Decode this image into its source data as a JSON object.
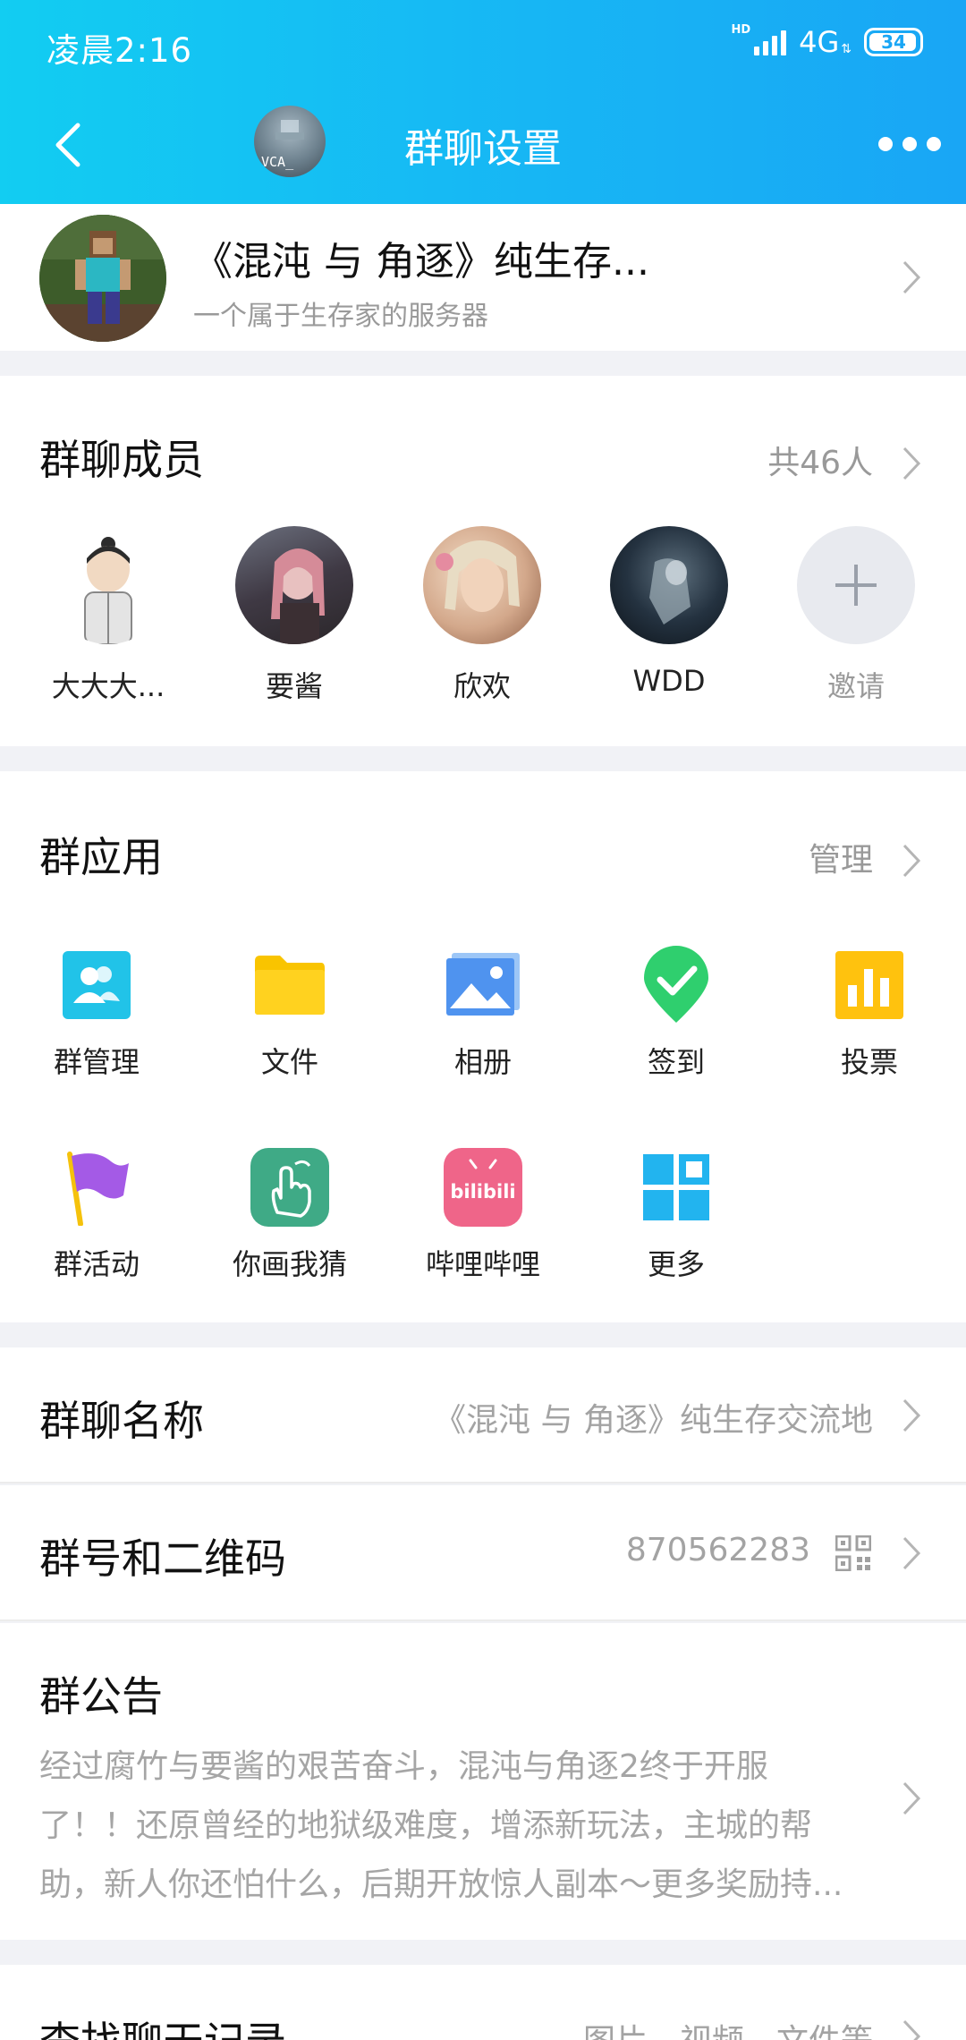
{
  "status_bar": {
    "time": "凌晨2:16",
    "hd": "HD",
    "network": "4G",
    "battery": "34"
  },
  "nav": {
    "title": "群聊设置",
    "group_thumb_text": "VCA_"
  },
  "group": {
    "name": "《混沌 与 角逐》纯生存...",
    "description": "一个属于生存家的服务器"
  },
  "members": {
    "title": "群聊成员",
    "count": "共46人",
    "list": [
      {
        "name": "大大大..."
      },
      {
        "name": "要酱"
      },
      {
        "name": "欣欢"
      },
      {
        "name": "WDD"
      }
    ],
    "invite_label": "邀请"
  },
  "apps": {
    "title": "群应用",
    "manage": "管理",
    "items": [
      {
        "label": "群管理",
        "icon": "group-manage-icon"
      },
      {
        "label": "文件",
        "icon": "folder-icon"
      },
      {
        "label": "相册",
        "icon": "photo-album-icon"
      },
      {
        "label": "签到",
        "icon": "check-in-icon"
      },
      {
        "label": "投票",
        "icon": "vote-icon"
      },
      {
        "label": "群活动",
        "icon": "flag-icon"
      },
      {
        "label": "你画我猜",
        "icon": "draw-guess-icon"
      },
      {
        "label": "哔哩哔哩",
        "icon": "bilibili-icon"
      },
      {
        "label": "更多",
        "icon": "more-grid-icon"
      }
    ],
    "bilibili_logo_text": "bilibili"
  },
  "group_name_row": {
    "title": "群聊名称",
    "value": "《混沌 与 角逐》纯生存交流地"
  },
  "group_id_row": {
    "title": "群号和二维码",
    "value": "870562283"
  },
  "notice": {
    "title": "群公告",
    "lines": [
      "经过腐竹与要酱的艰苦奋斗，混沌与角逐2终于开服",
      "了！！还原曾经的地狱级难度，增添新玩法，主城的帮",
      "助，新人你还怕什么，后期开放惊人副本～更多奖励持..."
    ]
  },
  "search_history": {
    "title": "查找聊天记录",
    "value": "图片、视频、文件等"
  },
  "colors": {
    "header_start": "#12cdf2",
    "header_end": "#19a6f5",
    "secondary_text": "#9a9a9a"
  }
}
